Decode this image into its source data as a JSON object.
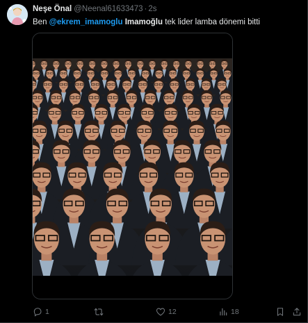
{
  "author": {
    "name": "Neşe Önal",
    "handle": "@Neenal61633473",
    "separator": "·",
    "time": "2s"
  },
  "tweet": {
    "word_before": "Ben",
    "mention": "@ekrem_imamoglu",
    "bold_word": "Imamoğlu",
    "rest": "tek lider lamba dönemi bitti"
  },
  "media": {
    "icon": "photo-collage-of-repeated-man-in-suit"
  },
  "actions": {
    "reply_count": "1",
    "retweet_count": "",
    "like_count": "12",
    "view_count": "18"
  },
  "colors": {
    "background": "#000000",
    "text": "#e7e9ea",
    "secondary": "#71767b",
    "accent": "#1d9bf0",
    "border": "#2f3336"
  }
}
